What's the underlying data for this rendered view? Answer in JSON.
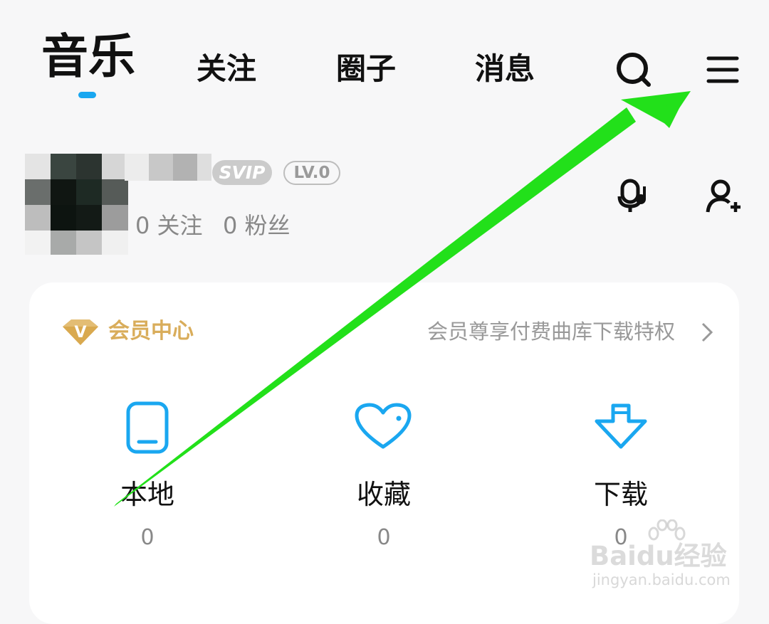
{
  "top_tabs": [
    {
      "label": "音乐",
      "active": true
    },
    {
      "label": "关注",
      "active": false
    },
    {
      "label": "圈子",
      "active": false
    },
    {
      "label": "消息",
      "active": false
    }
  ],
  "header_icons": {
    "search": "search-icon",
    "menu": "hamburger-menu-icon"
  },
  "profile": {
    "svip_badge": "SVIP",
    "level_badge": "LV.0",
    "following": "0 关注",
    "fans": "0 粉丝",
    "icons": {
      "voice": "voice-room-icon",
      "add_friend": "add-user-icon"
    }
  },
  "vip_center": {
    "icon": "diamond-v-icon",
    "title": "会员中心",
    "description": "会员尊享付费曲库下载特权"
  },
  "shortcuts": [
    {
      "icon": "phone-icon",
      "label": "本地",
      "count": "0"
    },
    {
      "icon": "heart-icon",
      "label": "收藏",
      "count": "0"
    },
    {
      "icon": "download-icon",
      "label": "下载",
      "count": "0"
    }
  ],
  "watermark": {
    "logo": "Baidu经验",
    "site": "jingyan.baidu.com"
  },
  "colors": {
    "accent": "#1aa7f0",
    "vip_gold": "#d9ad5b",
    "annotation_arrow": "#22e01a",
    "background": "#f7f7f8"
  }
}
